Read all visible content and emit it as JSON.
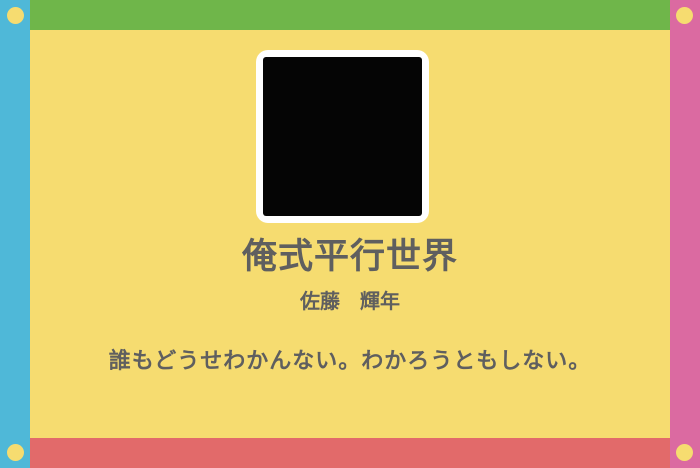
{
  "card": {
    "title": "俺式平行世界",
    "author": "佐藤　輝年",
    "tagline": "誰もどうせわかんない。わかろうともしない。"
  },
  "colors": {
    "background": "#f6dc70",
    "top_band": "#6fb64a",
    "bottom_band": "#e26a6a",
    "left_band": "#4fb8d8",
    "right_band": "#db6aa1",
    "corner_dots": "#f6dc70",
    "text": "#5f5f5f",
    "cover_border": "#ffffff",
    "cover_image": "#050505"
  },
  "icons": {
    "cover": "black-square-cover-image",
    "corner_markers": "yellow-circle-dot"
  }
}
